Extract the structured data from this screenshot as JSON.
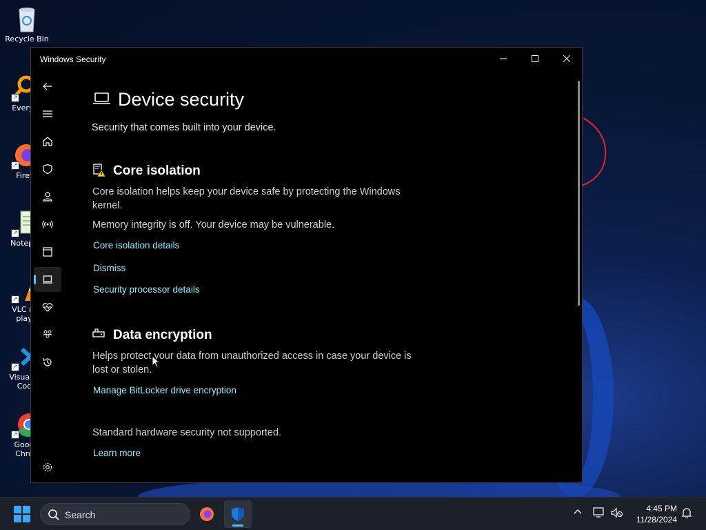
{
  "desktop": {
    "icons": [
      {
        "label": "Recycle Bin"
      },
      {
        "label": "Everyt"
      },
      {
        "label": "Firef"
      },
      {
        "label": "Notepa"
      },
      {
        "label": "VLC m",
        "label2": "play"
      },
      {
        "label": "Visual S",
        "label2": "Coc"
      },
      {
        "label": "Goog",
        "label2": "Chro"
      }
    ]
  },
  "window": {
    "title": "Windows Security",
    "controls": {
      "minimize": "—",
      "maximize": "☐",
      "close": "✕"
    }
  },
  "nav": {
    "items": [
      {
        "icon": "back-arrow-icon"
      },
      {
        "icon": "hamburger-menu-icon"
      },
      {
        "icon": "home-icon"
      },
      {
        "icon": "shield-icon"
      },
      {
        "icon": "account-icon"
      },
      {
        "icon": "network-icon"
      },
      {
        "icon": "app-browser-icon"
      },
      {
        "icon": "device-security-icon",
        "active": true
      },
      {
        "icon": "device-health-icon"
      },
      {
        "icon": "family-icon"
      },
      {
        "icon": "history-icon"
      },
      {
        "icon": "settings-icon"
      }
    ]
  },
  "page": {
    "title": "Device security",
    "subtitle": "Security that comes built into your device."
  },
  "core_isolation": {
    "title": "Core isolation",
    "description": "Core isolation helps keep your device safe by protecting the Windows kernel.",
    "status": "Memory integrity is off. Your device may be vulnerable.",
    "details_link": "Core isolation details",
    "dismiss_link": "Dismiss",
    "processor_link": "Security processor details"
  },
  "data_encryption": {
    "title": "Data encryption",
    "description": "Helps protect your data from unauthorized access in case your device is lost or stolen.",
    "bitlocker_link": "Manage BitLocker drive encryption"
  },
  "hardware": {
    "status": "Standard hardware security not supported.",
    "learn_more": "Learn more"
  },
  "taskbar": {
    "search_label": "Search",
    "time": "4:45 PM",
    "date": "11/28/2024"
  },
  "colors": {
    "link": "#99ebff",
    "accent": "#4cc2ff",
    "window_bg": "#000000"
  }
}
